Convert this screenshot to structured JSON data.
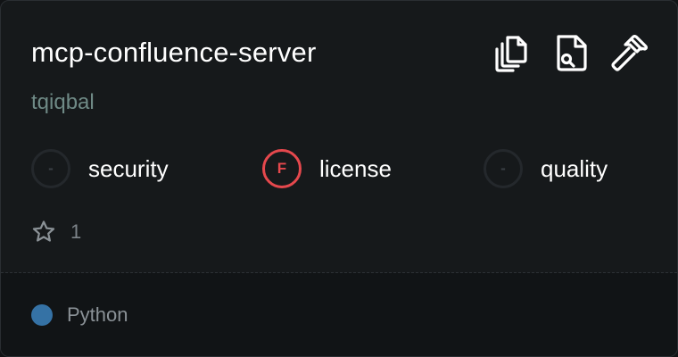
{
  "card": {
    "title": "mcp-confluence-server",
    "owner": "tqiqbal",
    "actions": [
      {
        "name": "copy-icon"
      },
      {
        "name": "file-search-icon"
      },
      {
        "name": "hammer-icon"
      }
    ],
    "scores": [
      {
        "grade": "-",
        "label": "security",
        "status": "none"
      },
      {
        "grade": "F",
        "label": "license",
        "status": "fail"
      },
      {
        "grade": "-",
        "label": "quality",
        "status": "none"
      }
    ],
    "stars": {
      "icon": "star-icon",
      "count": "1"
    },
    "language": {
      "label": "Python",
      "color": "#3572a5"
    }
  },
  "colors": {
    "background": "#16191b",
    "footer_background": "#111416",
    "owner_text": "#6f8a86",
    "fail": "#e5484d",
    "python": "#3572a5"
  }
}
